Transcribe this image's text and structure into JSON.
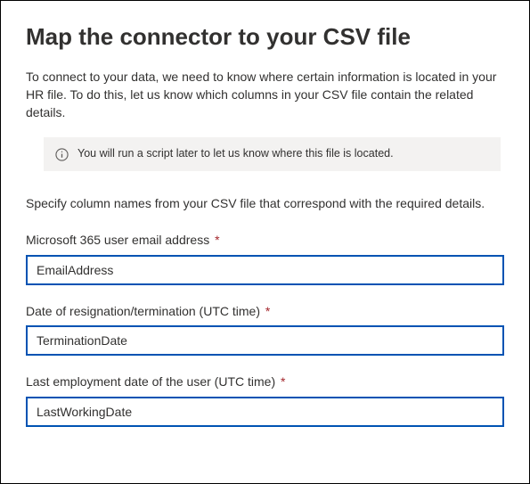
{
  "title": "Map the connector to your CSV file",
  "intro": "To connect to your data, we need to know where certain information is located in your HR file. To do this, let us know which columns in your CSV file contain the related details.",
  "info_banner": {
    "text": "You will run a script later to let us know where this file is located."
  },
  "instruction": "Specify column names from your CSV file that correspond with the required details.",
  "fields": [
    {
      "label": "Microsoft 365 user email address",
      "required": true,
      "value": "EmailAddress"
    },
    {
      "label": "Date of resignation/termination (UTC time)",
      "required": true,
      "value": "TerminationDate"
    },
    {
      "label": "Last employment date of the user (UTC time)",
      "required": true,
      "value": "LastWorkingDate"
    }
  ]
}
